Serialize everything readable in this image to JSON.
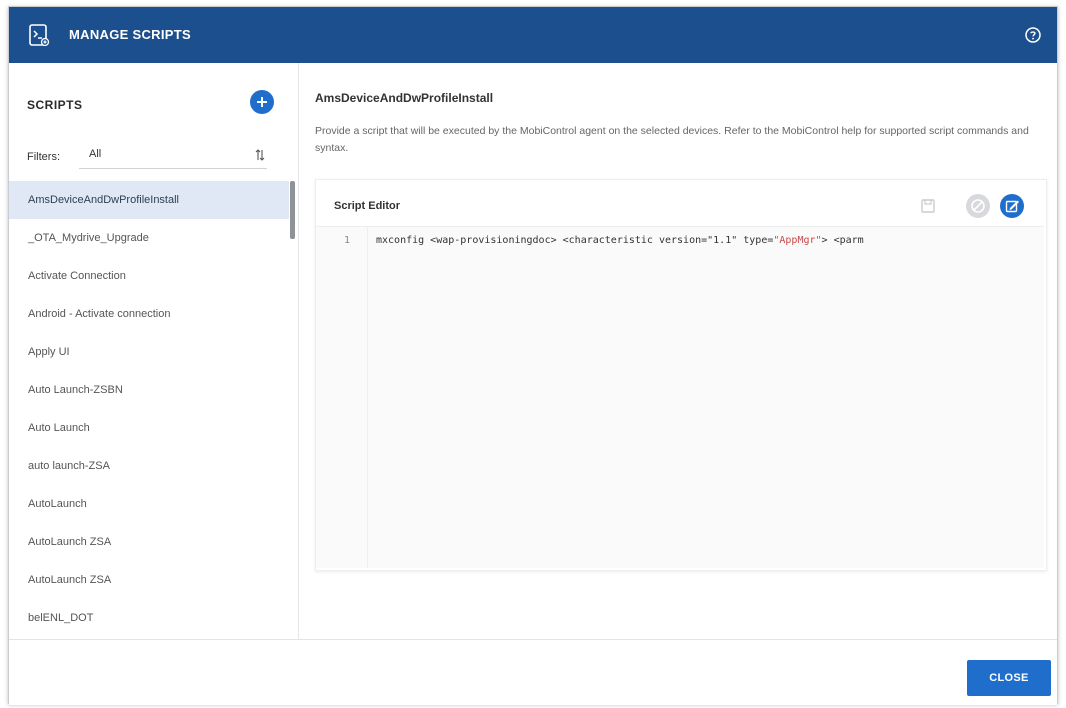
{
  "window": {
    "title": "MANAGE SCRIPTS",
    "title_icon": "script-device-icon",
    "help_icon": "help-icon"
  },
  "sidebar": {
    "title": "SCRIPTS",
    "add_icon": "plus-icon",
    "filter_label": "Filters:",
    "filter_value": "All",
    "filter_sort_icon": "sort-az-icon",
    "items": [
      {
        "label": "AmsDeviceAndDwProfileInstall",
        "selected": true
      },
      {
        "label": "_OTA_Mydrive_Upgrade"
      },
      {
        "label": "Activate Connection"
      },
      {
        "label": "Android - Activate connection"
      },
      {
        "label": "Apply UI"
      },
      {
        "label": "Auto Launch-ZSBN"
      },
      {
        "label": "Auto Launch"
      },
      {
        "label": "auto launch-ZSA"
      },
      {
        "label": "AutoLaunch"
      },
      {
        "label": "AutoLaunch ZSA"
      },
      {
        "label": "AutoLaunch ZSA"
      },
      {
        "label": "belENL_DOT"
      }
    ]
  },
  "main": {
    "script_name": "AmsDeviceAndDwProfileInstall",
    "description": "Provide a script that will be executed by the MobiControl agent on the selected devices. Refer to the MobiControl help for supported script commands and syntax.",
    "editor": {
      "title": "Script Editor",
      "save_icon": "save-icon",
      "cancel_icon": "cancel-icon",
      "edit_icon": "edit-icon",
      "line_number": "1",
      "code_pre": "mxconfig <wap-provisioningdoc> <characteristic version=",
      "code_str1": "\"1.1\"",
      "code_mid": " type=",
      "code_str2": "\"AppMgr\"",
      "code_post": "> <parm"
    }
  },
  "footer": {
    "close_label": "CLOSE"
  },
  "colors": {
    "titlebar": "#1c4f8d",
    "accent": "#1f6ecc",
    "selected_row": "#dfe8f4"
  }
}
